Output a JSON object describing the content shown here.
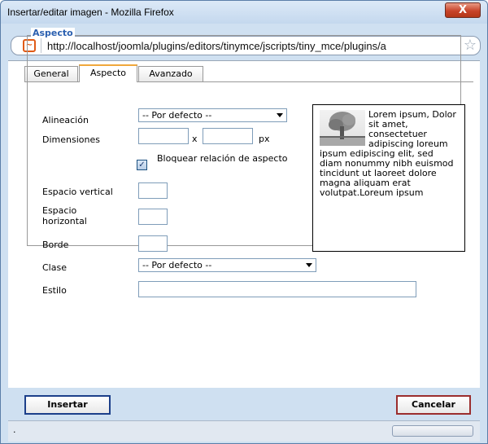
{
  "window": {
    "title": "Insertar/editar imagen - Mozilla Firefox",
    "close_glyph": "X"
  },
  "urlbar": {
    "url": "http://localhost/joomla/plugins/editors/tinymce/jscripts/tiny_mce/plugins/a"
  },
  "tabs": [
    {
      "label": "General"
    },
    {
      "label": "Aspecto"
    },
    {
      "label": "Avanzado"
    }
  ],
  "fieldset": {
    "legend": "Aspecto"
  },
  "form": {
    "alineacion_label": "Alineación",
    "alineacion_value": "-- Por defecto --",
    "dimensiones_label": "Dimensiones",
    "dim_sep": "x",
    "dim_unit": "px",
    "bloquear_label": "Bloquear relación de aspecto",
    "bloquear_checked": true,
    "espacio_vertical_label": "Espacio vertical",
    "espacio_horizontal_label": "Espacio horizontal",
    "borde_label": "Borde",
    "clase_label": "Clase",
    "clase_value": "-- Por defecto --",
    "estilo_label": "Estilo"
  },
  "preview": {
    "text": "Lorem ipsum, Dolor sit amet, consectetuer adipiscing loreum ipsum edipiscing elit, sed diam nonummy nibh euismod tincidunt ut laoreet dolore magna aliquam erat volutpat.Loreum ipsum"
  },
  "buttons": {
    "insert": "Insertar",
    "cancel": "Cancelar"
  },
  "status": {
    "text": "."
  },
  "icons": [
    "firefox-page-icon",
    "bookmark-star-icon",
    "close-icon",
    "dropdown-arrow-icon",
    "checkbox-check-icon",
    "tree-thumbnail-icon"
  ],
  "colors": {
    "legend": "#2b60b0",
    "active_tab_accent": "#f0a83c",
    "close_button": "#c8442a"
  }
}
